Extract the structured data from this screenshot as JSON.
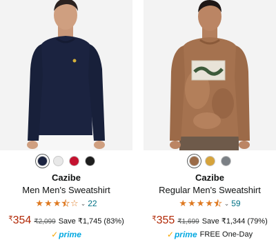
{
  "products": [
    {
      "image": {
        "description_icon": "navy-sweatshirt-model"
      },
      "swatches": [
        {
          "color": "#1b2340",
          "selected": true
        },
        {
          "color": "#e8e8e8",
          "selected": false
        },
        {
          "color": "#c4122f",
          "selected": false
        },
        {
          "color": "#1e1e1e",
          "selected": false
        }
      ],
      "brand": "Cazibe",
      "title": "Men Men's Sweatshirt",
      "rating": 3.5,
      "rating_count": "22",
      "price_symbol": "₹",
      "price": "354",
      "mrp": "₹2,099",
      "save": "Save ₹1,745 (83%)",
      "prime_label": "prime",
      "delivery": ""
    },
    {
      "image": {
        "description_icon": "tan-tiedye-sweatshirt-model"
      },
      "swatches": [
        {
          "color": "#9a6a46",
          "selected": true
        },
        {
          "color": "#d6a33b",
          "selected": false
        },
        {
          "color": "#7b8085",
          "selected": false
        }
      ],
      "brand": "Cazibe",
      "title": "Regular Men's Sweatshirt",
      "rating": 4.5,
      "rating_count": "59",
      "price_symbol": "₹",
      "price": "355",
      "mrp": "₹1,699",
      "save": "Save ₹1,344 (79%)",
      "prime_label": "prime",
      "delivery": "FREE One-Day"
    }
  ],
  "colors": {
    "price": "#b12704",
    "link": "#007185",
    "star": "#de7921",
    "prime": "#00a8e1"
  }
}
